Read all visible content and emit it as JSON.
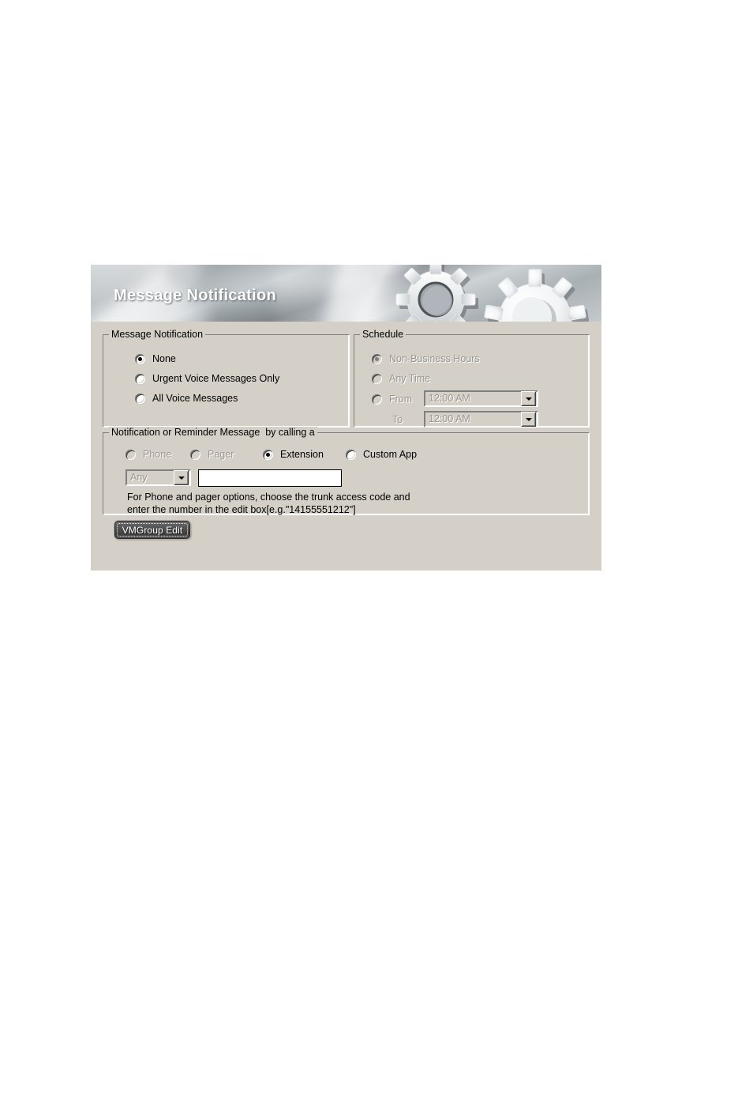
{
  "banner": {
    "title": "Message Notification",
    "gear_icon": "gears-icon"
  },
  "groups": {
    "message_notification": {
      "legend": "Message Notification",
      "options": [
        {
          "label": "None",
          "checked": true,
          "disabled": false
        },
        {
          "label": "Urgent Voice Messages Only",
          "checked": false,
          "disabled": false
        },
        {
          "label": "All Voice Messages",
          "checked": false,
          "disabled": false
        }
      ]
    },
    "schedule": {
      "legend": "Schedule",
      "options": [
        {
          "label": "Non-Business Hours",
          "checked": true,
          "disabled": true
        },
        {
          "label": "Any Time",
          "checked": false,
          "disabled": true
        },
        {
          "label": "From",
          "checked": false,
          "disabled": true
        }
      ],
      "to_label": "To",
      "from_time": "12:00 AM",
      "to_time": "12:00 AM",
      "dropdown_icon": "chevron-down-icon"
    },
    "reminder": {
      "legend": "Notification or Reminder Message  by calling a",
      "options": [
        {
          "label": "Phone",
          "checked": false,
          "disabled": true
        },
        {
          "label": "Pager",
          "checked": false,
          "disabled": true
        },
        {
          "label": "Extension",
          "checked": true,
          "disabled": false
        },
        {
          "label": "Custom App",
          "checked": false,
          "disabled": false
        }
      ],
      "trunk_select_value": "Any",
      "number_value": "",
      "number_placeholder": "",
      "help_text": "For Phone and pager options, choose the trunk access code and\nenter the number in the edit box[e.g.\"14155551212\"]"
    }
  },
  "buttons": {
    "vmgroup_edit": "VMGroup Edit"
  },
  "colors": {
    "dialog_face": "#d4d0c8",
    "disabled_text": "#9a968f",
    "button_dark": "#4a4a4a",
    "page_background": "#ffffff"
  }
}
